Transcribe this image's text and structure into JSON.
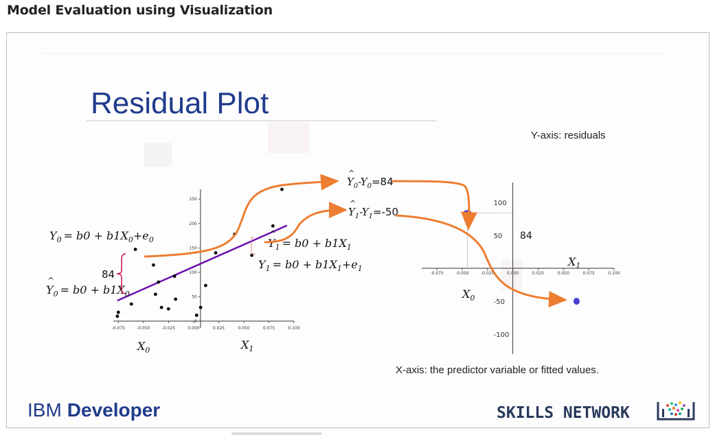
{
  "page": {
    "title": "Model Evaluation using Visualization"
  },
  "slide": {
    "heading": "Residual Plot",
    "y_axis_note": "Y-axis: residuals",
    "x_axis_note": "X-axis: the predictor variable or fitted values.",
    "footer_left_brand": "IBM",
    "footer_left_product": "Developer",
    "footer_right": "SKILLS NETWORK",
    "colors": {
      "heading": "#1f3b8c",
      "arrow": "#ed7d31",
      "regression_line": "#6a0dad",
      "residual_point": "#4a3fcf",
      "brace": "#cc1144"
    }
  },
  "annotations": {
    "y0_eq": "Y",
    "y0_rhs": "= b0 + b1X",
    "y0_plus": "+e",
    "y0hat_eq": "= b0 + b1X",
    "y1hat_eq": "= b0 + b1X",
    "y1_eq": "= b0 + b1X",
    "y1_plus": "+e",
    "gap_84": "84",
    "res0": "-Y",
    "res0_val": "=84",
    "res1": "-Y",
    "res1_val": "=-50",
    "x0_label": "X",
    "x1_label": "X",
    "sub0": "0",
    "sub1": "1",
    "res_x0_label": "X",
    "res_x1_label": "X",
    "res_84_label": "84"
  },
  "chart_data": [
    {
      "type": "scatter",
      "title": "",
      "xlabel": "",
      "ylabel": "",
      "xlim": [
        -0.08,
        0.1
      ],
      "ylim": [
        0,
        270
      ],
      "xticks": [
        "-0.075",
        "-0.050",
        "-0.025",
        "0.000",
        "0.025",
        "0.050",
        "0.075",
        "0.100"
      ],
      "yticks": [
        "0",
        "50",
        "100",
        "150",
        "200",
        "250"
      ],
      "x": [
        -0.076,
        -0.075,
        -0.062,
        -0.058,
        -0.04,
        -0.038,
        -0.035,
        -0.032,
        -0.025,
        -0.019,
        -0.018,
        0.003,
        0.007,
        0.012,
        0.022,
        0.041,
        0.058,
        0.079,
        0.088
      ],
      "y": [
        10,
        18,
        35,
        147,
        115,
        55,
        80,
        28,
        25,
        92,
        45,
        12,
        28,
        73,
        140,
        178,
        135,
        195,
        270
      ],
      "fit_line": {
        "x": [
          -0.076,
          0.093
        ],
        "y": [
          42,
          196
        ]
      }
    },
    {
      "type": "scatter",
      "title": "",
      "xlabel": "",
      "ylabel": "",
      "xlim": [
        -0.09,
        0.1
      ],
      "ylim": [
        -130,
        130
      ],
      "xticks": [
        "-0.075",
        "-0.050",
        "-0.025",
        "0.000",
        "0.025",
        "0.050",
        "0.075",
        "0.100"
      ],
      "yticks": [
        "100",
        "50",
        "-50",
        "-100"
      ],
      "x": [
        -0.045,
        0.063
      ],
      "y": [
        84,
        -50
      ]
    }
  ]
}
